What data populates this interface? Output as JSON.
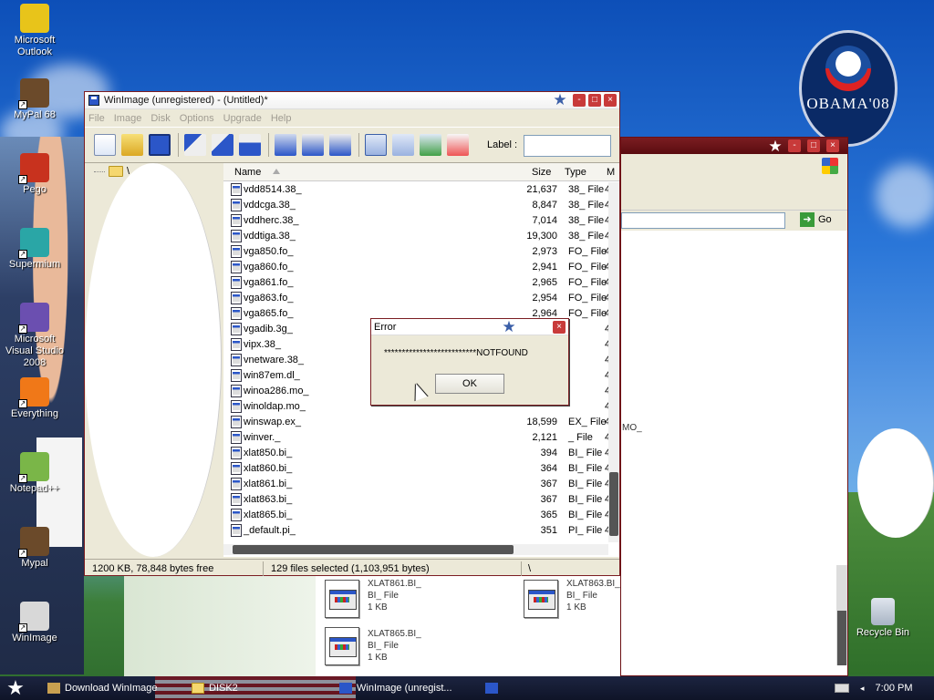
{
  "desktop": {
    "icons": [
      {
        "label": "Microsoft Outlook",
        "color": "#e8c41a"
      },
      {
        "label": "MyPal 68",
        "color": "#6b4a2a"
      },
      {
        "label": "Pego",
        "color": "#c8321e"
      },
      {
        "label": "Supermium",
        "color": "#2aa6a6"
      },
      {
        "label": "Microsoft Visual Studio 2008",
        "color": "#6b4fb0"
      },
      {
        "label": "Everything",
        "color": "#f07818"
      },
      {
        "label": "Notepad++",
        "color": "#7ab648"
      },
      {
        "label": "Mypal",
        "color": "#6b4a2a"
      },
      {
        "label": "WinImage",
        "color": "#d8d8d8"
      }
    ],
    "recycle_bin": "Recycle Bin",
    "obama_logo": "OBAMA'08"
  },
  "background_window": {
    "go_label": "Go",
    "fragment_text": "MO_",
    "files": [
      {
        "name": "XLAT861.BI_",
        "type": "BI_ File",
        "size": "1 KB"
      },
      {
        "name": "XLAT863.BI_",
        "type": "BI_ File",
        "size": "1 KB"
      },
      {
        "name": "XLAT865.BI_",
        "type": "BI_ File",
        "size": "1 KB"
      }
    ]
  },
  "window": {
    "title": "WinImage (unregistered) - (Untitled)*",
    "menu": [
      "File",
      "Image",
      "Disk",
      "Options",
      "Upgrade",
      "Help"
    ],
    "toolbar_label": "Label :",
    "tree_root": "\\",
    "columns": {
      "name": "Name",
      "size": "Size",
      "type": "Type",
      "date": "M"
    },
    "files": [
      {
        "name": "vdd8514.38_",
        "size": "21,637",
        "type": "38_ File",
        "date": "4"
      },
      {
        "name": "vddcga.38_",
        "size": "8,847",
        "type": "38_ File",
        "date": "4"
      },
      {
        "name": "vddherc.38_",
        "size": "7,014",
        "type": "38_ File",
        "date": "4"
      },
      {
        "name": "vddtiga.38_",
        "size": "19,300",
        "type": "38_ File",
        "date": "4"
      },
      {
        "name": "vga850.fo_",
        "size": "2,973",
        "type": "FO_ File",
        "date": "4"
      },
      {
        "name": "vga860.fo_",
        "size": "2,941",
        "type": "FO_ File",
        "date": "4"
      },
      {
        "name": "vga861.fo_",
        "size": "2,965",
        "type": "FO_ File",
        "date": "4"
      },
      {
        "name": "vga863.fo_",
        "size": "2,954",
        "type": "FO_ File",
        "date": "4"
      },
      {
        "name": "vga865.fo_",
        "size": "2,964",
        "type": "FO_ File",
        "date": "4"
      },
      {
        "name": "vgadib.3g_",
        "size": "",
        "type": "",
        "date": "4"
      },
      {
        "name": "vipx.38_",
        "size": "",
        "type": "",
        "date": "4"
      },
      {
        "name": "vnetware.38_",
        "size": "",
        "type": "",
        "date": "4"
      },
      {
        "name": "win87em.dl_",
        "size": "",
        "type": "",
        "date": "4"
      },
      {
        "name": "winoa286.mo_",
        "size": "",
        "type": "",
        "date": "4"
      },
      {
        "name": "winoldap.mo_",
        "size": "",
        "type": "",
        "date": "4"
      },
      {
        "name": "winswap.ex_",
        "size": "18,599",
        "type": "EX_ File",
        "date": "4"
      },
      {
        "name": "winver._",
        "size": "2,121",
        "type": "_ File",
        "date": "4"
      },
      {
        "name": "xlat850.bi_",
        "size": "394",
        "type": "BI_ File",
        "date": "4"
      },
      {
        "name": "xlat860.bi_",
        "size": "364",
        "type": "BI_ File",
        "date": "4"
      },
      {
        "name": "xlat861.bi_",
        "size": "367",
        "type": "BI_ File",
        "date": "4"
      },
      {
        "name": "xlat863.bi_",
        "size": "367",
        "type": "BI_ File",
        "date": "4"
      },
      {
        "name": "xlat865.bi_",
        "size": "365",
        "type": "BI_ File",
        "date": "4"
      },
      {
        "name": "_default.pi_",
        "size": "351",
        "type": "PI_ File",
        "date": "4"
      }
    ],
    "status": {
      "free": "1200 KB, 78,848 bytes free",
      "selected": "129 files selected (1,103,951 bytes)",
      "path": "\\"
    }
  },
  "dialog": {
    "title": "Error",
    "message": "**************************NOTFOUND",
    "ok_label": "OK"
  },
  "taskbar": {
    "tasks": [
      "Download WinImage",
      "DISK2",
      "WinImage (unregist..."
    ],
    "clock": "7:00 PM"
  }
}
